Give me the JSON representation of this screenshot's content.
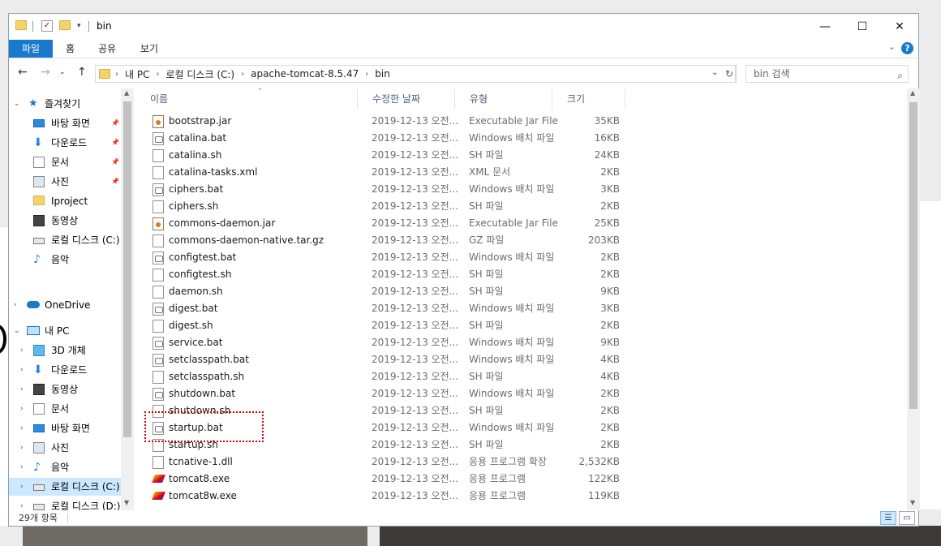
{
  "window": {
    "title": "bin",
    "controls": {
      "minimize": "—",
      "maximize": "☐",
      "close": "✕"
    }
  },
  "ribbon": {
    "tabs": [
      "파일",
      "홈",
      "공유",
      "보기"
    ],
    "help": "?"
  },
  "address": {
    "segments": [
      "내 PC",
      "로컬 디스크 (C:)",
      "apache-tomcat-8.5.47",
      "bin"
    ],
    "search_placeholder": "bin 검색"
  },
  "nav": {
    "quick_access": "즐겨찾기",
    "quick_items": [
      {
        "label": "바탕 화면",
        "icon": "desktop-icon",
        "pinned": true
      },
      {
        "label": "다운로드",
        "icon": "download-icon",
        "pinned": true
      },
      {
        "label": "문서",
        "icon": "document-icon",
        "pinned": true
      },
      {
        "label": "사진",
        "icon": "pictures-icon",
        "pinned": true
      },
      {
        "label": "Iproject",
        "icon": "folder-icon",
        "pinned": false
      },
      {
        "label": "동영상",
        "icon": "video-icon",
        "pinned": false
      },
      {
        "label": "로컬 디스크 (C:)",
        "icon": "drive-icon",
        "pinned": false
      },
      {
        "label": "음악",
        "icon": "music-icon",
        "pinned": false
      }
    ],
    "onedrive": "OneDrive",
    "this_pc": "내 PC",
    "pc_items": [
      {
        "label": "3D 개체",
        "icon": "3d-objects-icon"
      },
      {
        "label": "다운로드",
        "icon": "download-icon"
      },
      {
        "label": "동영상",
        "icon": "video-icon"
      },
      {
        "label": "문서",
        "icon": "document-icon"
      },
      {
        "label": "바탕 화면",
        "icon": "desktop-icon"
      },
      {
        "label": "사진",
        "icon": "pictures-icon"
      },
      {
        "label": "음악",
        "icon": "music-icon"
      },
      {
        "label": "로컬 디스크 (C:)",
        "icon": "drive-icon"
      },
      {
        "label": "로컬 디스크 (D:)",
        "icon": "drive-icon"
      }
    ]
  },
  "columns": {
    "name": "이름",
    "date": "수정한 날짜",
    "type": "유형",
    "size": "크기"
  },
  "files": [
    {
      "name": "bootstrap.jar",
      "date": "2019-12-13 오전...",
      "type": "Executable Jar File",
      "size": "35KB",
      "icon": "jar"
    },
    {
      "name": "catalina.bat",
      "date": "2019-12-13 오전...",
      "type": "Windows 배치 파일",
      "size": "16KB",
      "icon": "bat"
    },
    {
      "name": "catalina.sh",
      "date": "2019-12-13 오전...",
      "type": "SH 파일",
      "size": "24KB",
      "icon": "doc"
    },
    {
      "name": "catalina-tasks.xml",
      "date": "2019-12-13 오전...",
      "type": "XML 문서",
      "size": "2KB",
      "icon": "doc"
    },
    {
      "name": "ciphers.bat",
      "date": "2019-12-13 오전...",
      "type": "Windows 배치 파일",
      "size": "3KB",
      "icon": "bat"
    },
    {
      "name": "ciphers.sh",
      "date": "2019-12-13 오전...",
      "type": "SH 파일",
      "size": "2KB",
      "icon": "doc"
    },
    {
      "name": "commons-daemon.jar",
      "date": "2019-12-13 오전...",
      "type": "Executable Jar File",
      "size": "25KB",
      "icon": "jar"
    },
    {
      "name": "commons-daemon-native.tar.gz",
      "date": "2019-12-13 오전...",
      "type": "GZ 파일",
      "size": "203KB",
      "icon": "doc"
    },
    {
      "name": "configtest.bat",
      "date": "2019-12-13 오전...",
      "type": "Windows 배치 파일",
      "size": "2KB",
      "icon": "bat"
    },
    {
      "name": "configtest.sh",
      "date": "2019-12-13 오전...",
      "type": "SH 파일",
      "size": "2KB",
      "icon": "doc"
    },
    {
      "name": "daemon.sh",
      "date": "2019-12-13 오전...",
      "type": "SH 파일",
      "size": "9KB",
      "icon": "doc"
    },
    {
      "name": "digest.bat",
      "date": "2019-12-13 오전...",
      "type": "Windows 배치 파일",
      "size": "3KB",
      "icon": "bat"
    },
    {
      "name": "digest.sh",
      "date": "2019-12-13 오전...",
      "type": "SH 파일",
      "size": "2KB",
      "icon": "doc"
    },
    {
      "name": "service.bat",
      "date": "2019-12-13 오전...",
      "type": "Windows 배치 파일",
      "size": "9KB",
      "icon": "bat"
    },
    {
      "name": "setclasspath.bat",
      "date": "2019-12-13 오전...",
      "type": "Windows 배치 파일",
      "size": "4KB",
      "icon": "bat"
    },
    {
      "name": "setclasspath.sh",
      "date": "2019-12-13 오전...",
      "type": "SH 파일",
      "size": "4KB",
      "icon": "doc"
    },
    {
      "name": "shutdown.bat",
      "date": "2019-12-13 오전...",
      "type": "Windows 배치 파일",
      "size": "2KB",
      "icon": "bat"
    },
    {
      "name": "shutdown.sh",
      "date": "2019-12-13 오전...",
      "type": "SH 파일",
      "size": "2KB",
      "icon": "doc"
    },
    {
      "name": "startup.bat",
      "date": "2019-12-13 오전...",
      "type": "Windows 배치 파일",
      "size": "2KB",
      "icon": "bat"
    },
    {
      "name": "startup.sh",
      "date": "2019-12-13 오전...",
      "type": "SH 파일",
      "size": "2KB",
      "icon": "doc"
    },
    {
      "name": "tcnative-1.dll",
      "date": "2019-12-13 오전...",
      "type": "응용 프로그램 확장",
      "size": "2,532KB",
      "icon": "doc"
    },
    {
      "name": "tomcat8.exe",
      "date": "2019-12-13 오전...",
      "type": "응용 프로그램",
      "size": "122KB",
      "icon": "exe"
    },
    {
      "name": "tomcat8w.exe",
      "date": "2019-12-13 오전...",
      "type": "응용 프로그램",
      "size": "119KB",
      "icon": "exe"
    }
  ],
  "status": {
    "item_count": "29개 항목"
  },
  "colors": {
    "accent": "#1979ca",
    "highlight": "#d40000",
    "selection": "#cce8ff"
  }
}
